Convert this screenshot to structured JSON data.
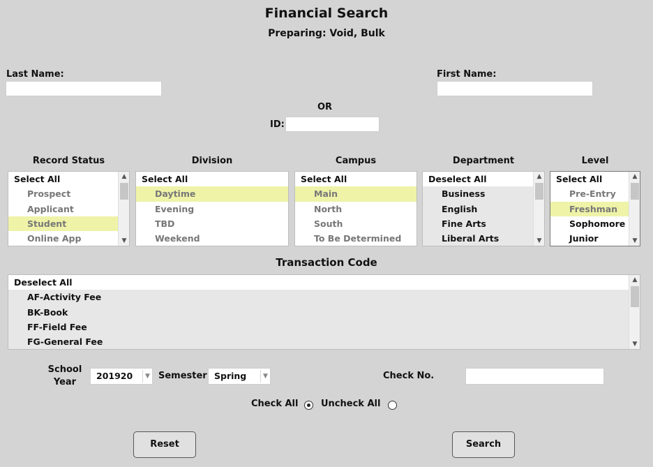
{
  "title": "Financial Search",
  "subtitle": "Preparing: Void, Bulk",
  "last_name": {
    "label": "Last Name:",
    "value": ""
  },
  "first_name": {
    "label": "First Name:",
    "value": ""
  },
  "or_label": "OR",
  "id_field": {
    "label": "ID:",
    "value": ""
  },
  "record_status": {
    "title": "Record Status",
    "header": "Select All",
    "items": [
      "Prospect",
      "Applicant",
      "Student",
      "Online App"
    ],
    "selected": "Student"
  },
  "division": {
    "title": "Division",
    "header": "Select All",
    "items": [
      "Daytime",
      "Evening",
      "TBD",
      "Weekend"
    ],
    "selected": "Daytime"
  },
  "campus": {
    "title": "Campus",
    "header": "Select All",
    "items": [
      "Main",
      "North",
      "South",
      "To Be Determined"
    ],
    "selected": "Main"
  },
  "department": {
    "title": "Department",
    "header": "Deselect All",
    "items": [
      "Business",
      "English",
      "Fine Arts",
      "Liberal Arts"
    ]
  },
  "level": {
    "title": "Level",
    "header": "Select All",
    "items": [
      "Pre-Entry",
      "Freshman",
      "Sophomore",
      "Junior"
    ],
    "selected": "Freshman"
  },
  "transaction_code": {
    "title": "Transaction Code",
    "header": "Deselect All",
    "items": [
      "AF-Activity Fee",
      "BK-Book",
      "FF-Field Fee",
      "FG-General Fee"
    ]
  },
  "school_year": {
    "label_line1": "School",
    "label_line2": "Year",
    "value": "201920"
  },
  "semester": {
    "label": "Semester",
    "value": "Spring"
  },
  "check_no": {
    "label": "Check No.",
    "value": ""
  },
  "check_all": {
    "label": "Check All",
    "checked": true
  },
  "uncheck_all": {
    "label": "Uncheck All",
    "checked": false
  },
  "buttons": {
    "reset": "Reset",
    "search": "Search"
  },
  "colors": {
    "background": "#d4d4d4",
    "selection_highlight": "#eef3a8"
  }
}
